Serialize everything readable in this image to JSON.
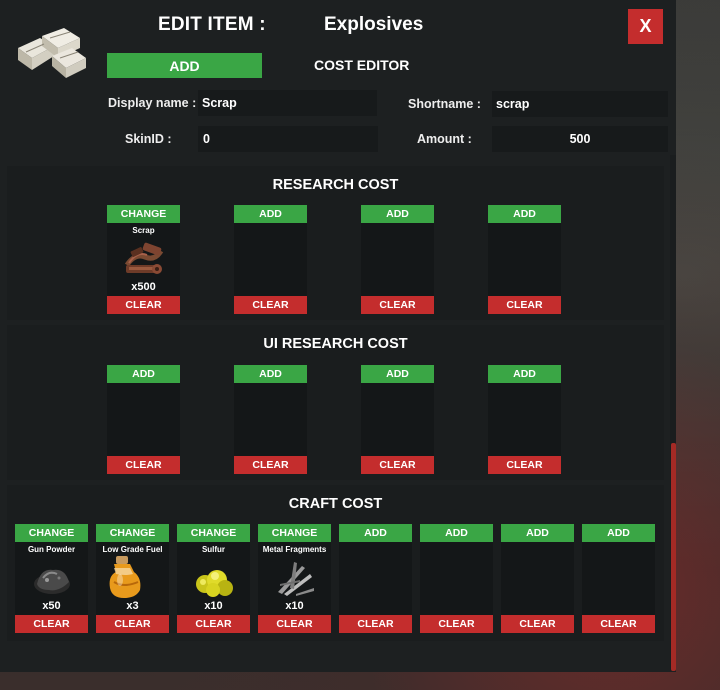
{
  "header": {
    "title_label": "EDIT ITEM :",
    "item_name": "Explosives",
    "close_label": "X",
    "add_label": "ADD",
    "cost_editor_label": "COST EDITOR",
    "item_icon": "explosives-icon"
  },
  "fields": {
    "display_name_label": "Display name :",
    "display_name_value": "Scrap",
    "shortname_label": "Shortname :",
    "shortname_value": "scrap",
    "skinid_label": "SkinID :",
    "skinid_value": "0",
    "amount_label": "Amount :",
    "amount_value": "500"
  },
  "research": {
    "title": "RESEARCH COST",
    "slots": [
      {
        "top": "CHANGE",
        "name": "Scrap",
        "amount": "x500",
        "clear": "CLEAR",
        "icon": "scrap-icon"
      },
      {
        "top": "ADD",
        "name": "",
        "amount": "",
        "clear": "CLEAR"
      },
      {
        "top": "ADD",
        "name": "",
        "amount": "",
        "clear": "CLEAR"
      },
      {
        "top": "ADD",
        "name": "",
        "amount": "",
        "clear": "CLEAR"
      }
    ]
  },
  "ui_research": {
    "title": "UI RESEARCH COST",
    "slots": [
      {
        "top": "ADD",
        "clear": "CLEAR"
      },
      {
        "top": "ADD",
        "clear": "CLEAR"
      },
      {
        "top": "ADD",
        "clear": "CLEAR"
      },
      {
        "top": "ADD",
        "clear": "CLEAR"
      }
    ]
  },
  "craft": {
    "title": "CRAFT COST",
    "slots": [
      {
        "top": "CHANGE",
        "name": "Gun Powder",
        "amount": "x50",
        "clear": "CLEAR",
        "icon": "gun-powder-icon"
      },
      {
        "top": "CHANGE",
        "name": "Low Grade Fuel",
        "amount": "x3",
        "clear": "CLEAR",
        "icon": "low-grade-fuel-icon"
      },
      {
        "top": "CHANGE",
        "name": "Sulfur",
        "amount": "x10",
        "clear": "CLEAR",
        "icon": "sulfur-icon"
      },
      {
        "top": "CHANGE",
        "name": "Metal Fragments",
        "amount": "x10",
        "clear": "CLEAR",
        "icon": "metal-fragments-icon"
      },
      {
        "top": "ADD",
        "clear": "CLEAR"
      },
      {
        "top": "ADD",
        "clear": "CLEAR"
      },
      {
        "top": "ADD",
        "clear": "CLEAR"
      },
      {
        "top": "ADD",
        "clear": "CLEAR"
      }
    ]
  },
  "colors": {
    "green": "#3aa645",
    "red": "#c42d2d",
    "panel": "#1d2021"
  }
}
